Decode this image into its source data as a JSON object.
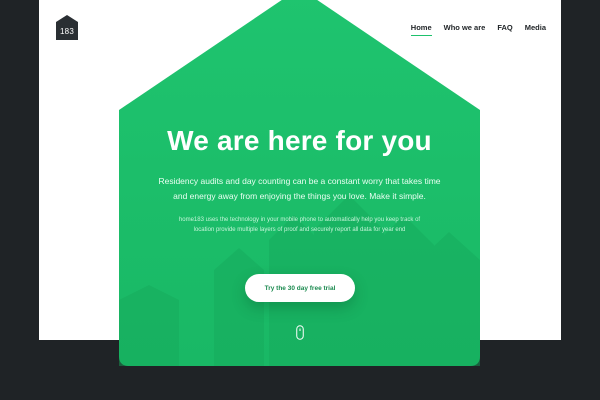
{
  "brand": {
    "logo_text": "183",
    "dark_color": "#2a2f33"
  },
  "nav": {
    "items": [
      {
        "label": "Home",
        "active": true
      },
      {
        "label": "Who we are",
        "active": false
      },
      {
        "label": "FAQ",
        "active": false
      },
      {
        "label": "Media",
        "active": false
      }
    ]
  },
  "hero": {
    "headline": "We are here for you",
    "lead": "Residency audits and day counting can be a constant worry that takes time and energy away from enjoying the things you love. Make it simple.",
    "small": "home183 uses the technology in your mobile phone to automatically help you keep track of location provide multiple layers of proof and securely report all data for year end",
    "cta_label": "Try the 30 day free trial",
    "accent_color": "#1ec16c",
    "scroll_icon": "mouse-scroll-icon"
  }
}
